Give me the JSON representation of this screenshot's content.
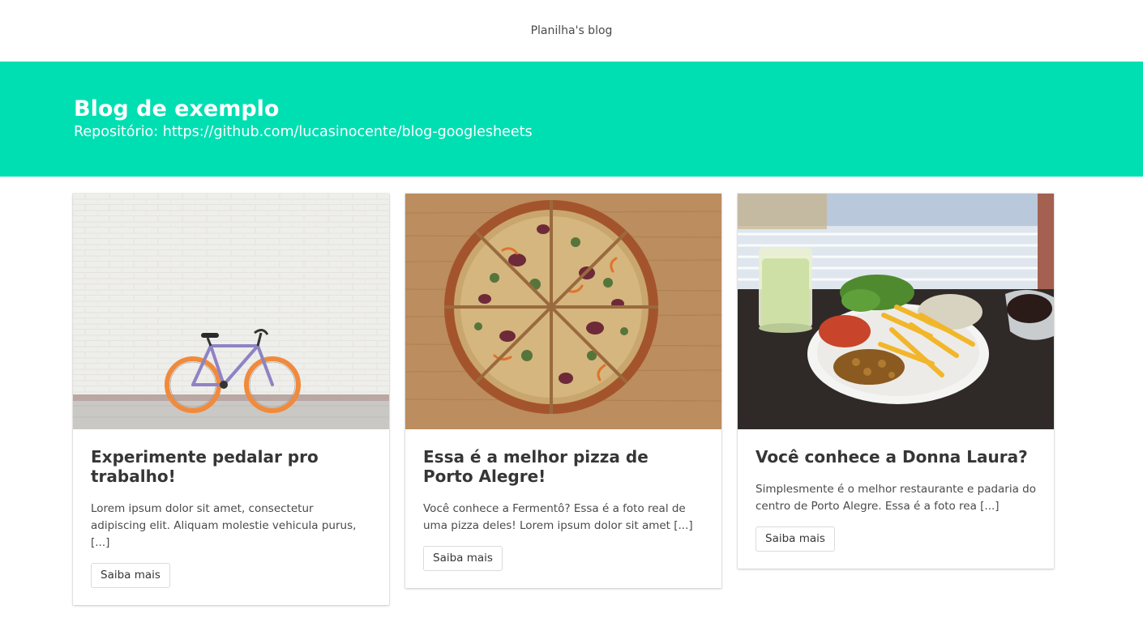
{
  "navbar": {
    "brand": "Planilha's blog"
  },
  "hero": {
    "title": "Blog de exemplo",
    "subtitle": "Repositório: https://github.com/lucasinocente/blog-googlesheets",
    "background_color": "#00dfb2"
  },
  "posts": [
    {
      "title": "Experimente pedalar pro trabalho!",
      "excerpt": "Lorem ipsum dolor sit amet, consectetur adipiscing elit. Aliquam molestie vehicula purus, [...]",
      "button": "Saiba mais",
      "image": "bicycle-photo"
    },
    {
      "title": "Essa é a melhor pizza de Porto Alegre!",
      "excerpt": "Você conhece a Fermentô? Essa é a foto real de uma pizza deles! Lorem ipsum dolor sit amet [...]",
      "button": "Saiba mais",
      "image": "pizza-photo"
    },
    {
      "title": "Você conhece a Donna Laura?",
      "excerpt": "Simplesmente é o melhor restaurante e padaria do centro de Porto Alegre. Essa é a foto rea [...]",
      "button": "Saiba mais",
      "image": "food-plate-photo"
    }
  ]
}
